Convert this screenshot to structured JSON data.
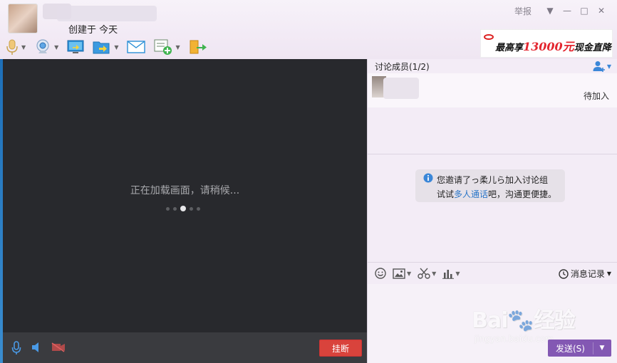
{
  "header": {
    "created_text": "创建于 今天",
    "report_label": "举报",
    "controls": {
      "dropdown": "▼",
      "minimize": "—",
      "maximize": "□",
      "close": "✕"
    }
  },
  "toolbar": {
    "items": [
      {
        "name": "microphone-icon",
        "has_dropdown": true
      },
      {
        "name": "camera-icon",
        "has_dropdown": true
      },
      {
        "name": "screen-share-icon",
        "has_dropdown": false
      },
      {
        "name": "send-file-icon",
        "has_dropdown": true
      },
      {
        "name": "mail-icon",
        "has_dropdown": false
      },
      {
        "name": "app-add-icon",
        "has_dropdown": true
      },
      {
        "name": "exit-icon",
        "has_dropdown": false
      }
    ]
  },
  "banner": {
    "text_before": "最高享",
    "amount": "13000元",
    "text_after": "现金直降"
  },
  "video": {
    "loading_text": "正在加载画面，请稍候...",
    "dots_count": 5,
    "active_dot_index": 2,
    "hangup_label": "挂断"
  },
  "members": {
    "heading": "讨论成员(1/2)",
    "pending_label": "待加入"
  },
  "notice": {
    "line1": "您邀请了っ柔儿ら加入讨论组",
    "line2_prefix": "试试",
    "line2_link": "多人通话",
    "line2_suffix": "吧，沟通更便捷。"
  },
  "input_toolbar": {
    "history_label": "消息记录"
  },
  "send": {
    "label": "发送(S)",
    "dropdown": "▼"
  },
  "watermark": {
    "brand": "Bai",
    "brand2": "经验",
    "sub": "jingyan.baidu.com"
  },
  "colors": {
    "accent_purple": "#8358b3",
    "hangup_red": "#d9433c",
    "video_bg": "#28292d",
    "link_blue": "#2a76c8"
  }
}
